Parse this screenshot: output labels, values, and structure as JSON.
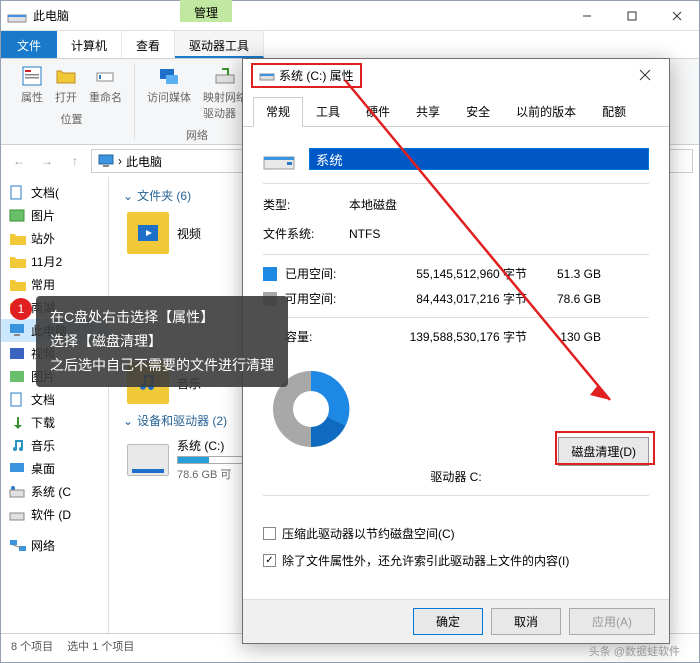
{
  "window": {
    "title": "此电脑",
    "manage_tab": "管理",
    "menubar": {
      "file": "文件",
      "computer": "计算机",
      "view": "查看",
      "drivetools": "驱动器工具"
    },
    "ribbon": {
      "props": "属性",
      "open": "打开",
      "rename": "重命名",
      "media": "访问媒体",
      "map": "映射网络\n驱动器",
      "group_location": "位置",
      "group_network": "网络"
    },
    "address": "此电脑",
    "statusbar": {
      "items": "8 个项目",
      "selected": "选中 1 个项目"
    }
  },
  "sidebar": {
    "items": [
      "文档(",
      "图片",
      "站外",
      "11月2",
      "常用",
      "南湖",
      "此电脑",
      "视频",
      "图片",
      "文档",
      "下载",
      "音乐",
      "桌面",
      "系统 (C",
      "软件 (D",
      "网络"
    ]
  },
  "main": {
    "folders_header": "文件夹 (6)",
    "video": "视频",
    "music": "音乐",
    "devices_header": "设备和驱动器 (2)",
    "drive_c": "系统 (C:)",
    "drive_c_space": "78.6 GB 可"
  },
  "dialog": {
    "title": "系统 (C:) 属性",
    "tabs": [
      "常规",
      "工具",
      "硬件",
      "共享",
      "安全",
      "以前的版本",
      "配额"
    ],
    "name_value": "系统",
    "type_label": "类型:",
    "type_value": "本地磁盘",
    "fs_label": "文件系统:",
    "fs_value": "NTFS",
    "used_label": "已用空间:",
    "used_bytes": "55,145,512,960 字节",
    "used_gb": "51.3 GB",
    "free_label": "可用空间:",
    "free_bytes": "84,443,017,216 字节",
    "free_gb": "78.6 GB",
    "cap_label": "容量:",
    "cap_bytes": "139,588,530,176 字节",
    "cap_gb": "130 GB",
    "drive_label": "驱动器 C:",
    "cleanup_btn": "磁盘清理(D)",
    "compress_check": "压缩此驱动器以节约磁盘空间(C)",
    "index_check": "除了文件属性外，还允许索引此驱动器上文件的内容(I)",
    "ok": "确定",
    "cancel": "取消",
    "apply": "应用(A)"
  },
  "annotation": {
    "badge": "1",
    "line1": "在C盘处右击选择【属性】",
    "line2": "选择【磁盘清理】",
    "line3": "之后选中自己不需要的文件进行清理"
  },
  "credit": "头条 @数据蛙软件",
  "chart_data": {
    "type": "pie",
    "title": "驱动器 C:",
    "series": [
      {
        "name": "已用空间",
        "value": 51.3,
        "bytes": 55145512960,
        "color": "#1e88e5"
      },
      {
        "name": "可用空间",
        "value": 78.6,
        "bytes": 84443017216,
        "color": "#a8a8a8"
      }
    ],
    "total": {
      "label": "容量",
      "value": 130,
      "bytes": 139588530176,
      "unit": "GB"
    }
  }
}
